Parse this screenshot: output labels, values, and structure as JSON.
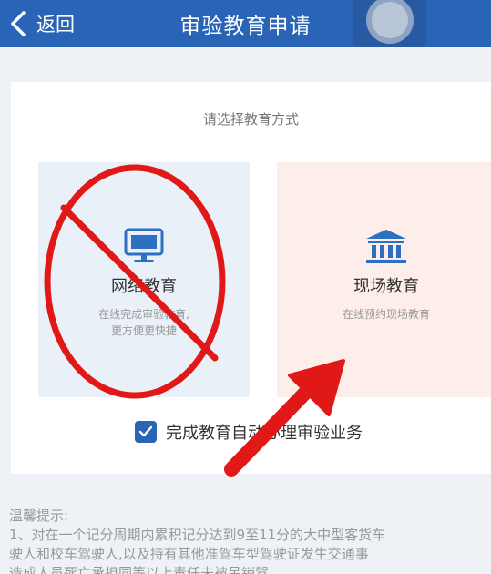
{
  "header": {
    "back_label": "返回",
    "title": "审验教育申请"
  },
  "main": {
    "prompt": "请选择教育方式",
    "options": [
      {
        "name": "网络教育",
        "desc_lines": [
          "在线完成审验教育,",
          "更方便更快捷"
        ]
      },
      {
        "name": "现场教育",
        "desc_lines": [
          "在线预约现场教育"
        ]
      }
    ],
    "confirm": {
      "checked": true,
      "label": "完成教育自动办理审验业务"
    }
  },
  "tips": {
    "title": "温馨提示:",
    "lines": [
      "1、对在一个记分周期内累积记分达到9至11分的大中型客货车",
      "驶人和校车驾驶人,以及持有其他准驾车型驾驶证发生交通事",
      "造成人员死亡承担同等以上责任未被吊销驾"
    ]
  },
  "colors": {
    "header": "#2a64b6",
    "annotation": "#e01818"
  },
  "icons": {
    "back": "chevron-left-icon",
    "online": "monitor-icon",
    "onsite": "bank-building-icon",
    "check": "checkmark-icon"
  }
}
